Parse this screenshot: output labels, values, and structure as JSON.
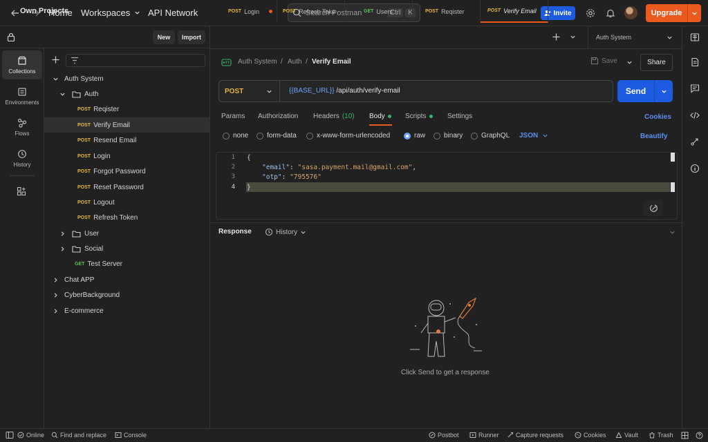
{
  "topbar": {
    "home": "Home",
    "workspaces": "Workspaces",
    "api_network": "API Network",
    "search_placeholder": "Search Postman",
    "shortcut_ctrl": "Ctrl",
    "shortcut_k": "K",
    "invite": "Invite",
    "upgrade": "Upgrade"
  },
  "workspace": {
    "title": "Own Projects",
    "new_label": "New",
    "import_label": "Import"
  },
  "rail": [
    {
      "label": "Collections",
      "icon": "collections-icon"
    },
    {
      "label": "Environments",
      "icon": "environments-icon"
    },
    {
      "label": "Flows",
      "icon": "flows-icon"
    },
    {
      "label": "History",
      "icon": "history-icon"
    }
  ],
  "tree": {
    "collection": "Auth System",
    "folder_auth": "Auth",
    "requests": [
      {
        "method": "POST",
        "name": "Reqister"
      },
      {
        "method": "POST",
        "name": "Verify Email"
      },
      {
        "method": "POST",
        "name": "Resend Email"
      },
      {
        "method": "POST",
        "name": "Login"
      },
      {
        "method": "POST",
        "name": "Forgot Password"
      },
      {
        "method": "POST",
        "name": "Reset Password"
      },
      {
        "method": "POST",
        "name": "Logout"
      },
      {
        "method": "POST",
        "name": "Refresh Token"
      }
    ],
    "folder_user": "User",
    "folder_social": "Social",
    "test_server": {
      "method": "GET",
      "name": "Test Server"
    },
    "other_collections": [
      "Chat APP",
      "CyberBackground",
      "E-commerce"
    ]
  },
  "tabs": [
    {
      "method": "POST",
      "name": "Login"
    },
    {
      "method": "POST",
      "name": "Refresh Toke"
    },
    {
      "method": "GET",
      "name": "Users"
    },
    {
      "method": "POST",
      "name": "Reqister"
    },
    {
      "method": "POST",
      "name": "Verify Email"
    }
  ],
  "environment": "Auth System",
  "breadcrumb": {
    "collection": "Auth System",
    "folder": "Auth",
    "current": "Verify Email",
    "sep": "/"
  },
  "actions": {
    "save": "Save",
    "share": "Share"
  },
  "request": {
    "method": "POST",
    "url_var": "{{BASE_URL}}",
    "url_path": " /api/auth/verify-email",
    "send": "Send"
  },
  "req_tabs": {
    "params": "Params",
    "authorization": "Authorization",
    "headers": "Headers",
    "headers_count": "(10)",
    "body": "Body",
    "scripts": "Scripts",
    "settings": "Settings",
    "cookies": "Cookies"
  },
  "body_types": [
    "none",
    "form-data",
    "x-www-form-urlencoded",
    "raw",
    "binary",
    "GraphQL"
  ],
  "body_format": "JSON",
  "beautify": "Beautify",
  "editor": {
    "line_numbers": [
      "1",
      "2",
      "3",
      "4"
    ],
    "open_brace": "{",
    "email_key": "\"email\"",
    "email_value": "\"sasa.payment.mail@gmail.com\"",
    "otp_key": "\"otp\"",
    "otp_value": "\"795576\"",
    "close_brace": "}"
  },
  "response": {
    "title": "Response",
    "history": "History",
    "empty": "Click Send to get a response"
  },
  "statusbar": {
    "online": "Online",
    "find_replace": "Find and replace",
    "console": "Console",
    "postbot": "Postbot",
    "runner": "Runner",
    "capture": "Capture requests",
    "cookies": "Cookies",
    "vault": "Vault",
    "trash": "Trash"
  },
  "colors": {
    "accent": "#ea5a1f",
    "primary": "#1d5be0",
    "post": "#e8b83e",
    "get": "#5bbf5b"
  }
}
